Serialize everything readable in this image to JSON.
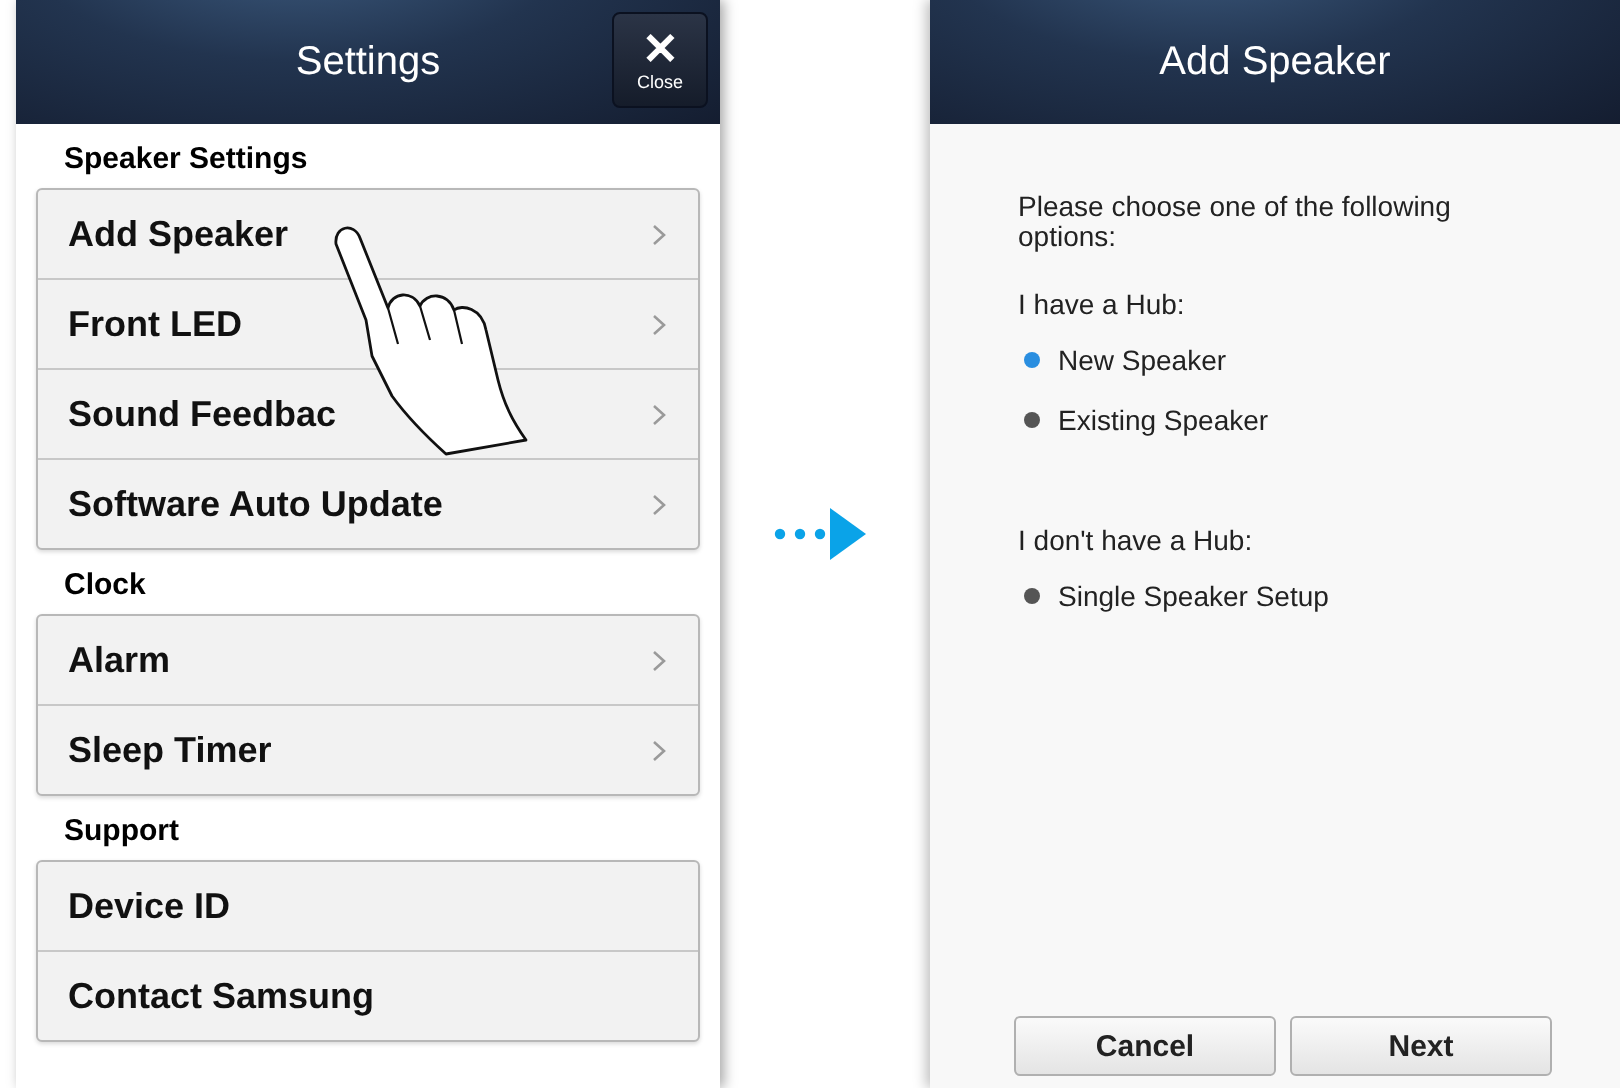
{
  "settings_screen": {
    "title": "Settings",
    "close_button": {
      "icon": "✕",
      "label": "Close"
    },
    "sections": [
      {
        "heading": "Speaker Settings",
        "items": [
          {
            "label": "Add Speaker",
            "chevron": true
          },
          {
            "label": "Front LED",
            "chevron": true
          },
          {
            "label": "Sound Feedbac",
            "chevron": true
          },
          {
            "label": "Software Auto Update",
            "chevron": true
          }
        ]
      },
      {
        "heading": "Clock",
        "items": [
          {
            "label": "Alarm",
            "chevron": true
          },
          {
            "label": "Sleep Timer",
            "chevron": true
          }
        ]
      },
      {
        "heading": "Support",
        "items": [
          {
            "label": "Device ID",
            "chevron": false
          },
          {
            "label": "Contact Samsung",
            "chevron": false
          }
        ]
      }
    ]
  },
  "add_speaker_screen": {
    "title": "Add Speaker",
    "prompt": "Please choose one of the following options:",
    "groups": [
      {
        "heading": "I have a Hub:",
        "options": [
          {
            "label": "New Speaker",
            "selected": true
          },
          {
            "label": "Existing Speaker",
            "selected": false
          }
        ]
      },
      {
        "heading": "I don't have a Hub:",
        "options": [
          {
            "label": "Single Speaker Setup",
            "selected": false
          }
        ]
      }
    ],
    "buttons": [
      "Cancel",
      "Next"
    ]
  }
}
